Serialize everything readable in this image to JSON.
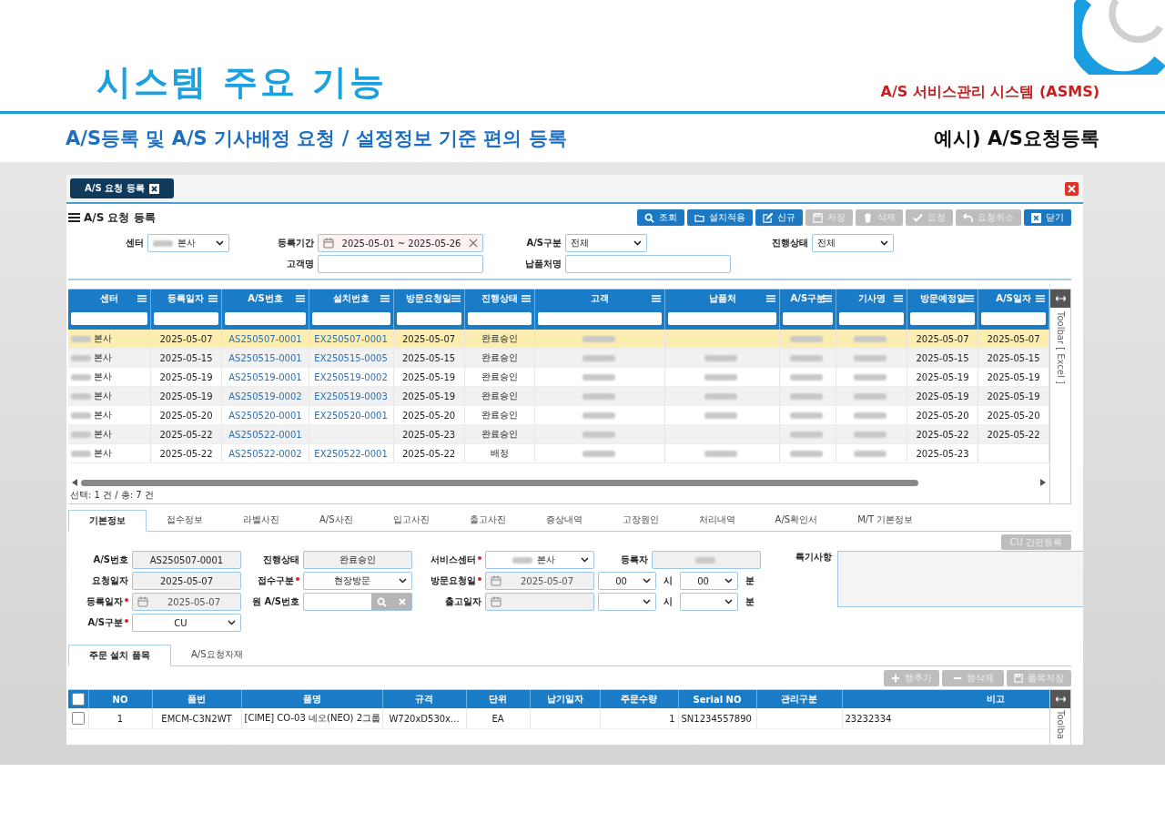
{
  "slide": {
    "title": "시스템 주요 기능",
    "system_name": "A/S 서비스관리 시스템 (ASMS)",
    "subtitle": "A/S등록 및 A/S 기사배정 요청 / 설정정보 기준 편의 등록",
    "example_label": "예시) A/S요청등록"
  },
  "window": {
    "tab": {
      "label": "A/S 요청 등록",
      "selected": true
    },
    "title": "A/S 요청 등록"
  },
  "toolbar": [
    {
      "label": "조회",
      "disabled": false
    },
    {
      "label": "설치적용",
      "disabled": false
    },
    {
      "label": "신규",
      "disabled": false
    },
    {
      "label": "저장",
      "disabled": true
    },
    {
      "label": "삭제",
      "disabled": true
    },
    {
      "label": "요청",
      "disabled": true
    },
    {
      "label": "요청취소",
      "disabled": true
    },
    {
      "label": "닫기",
      "disabled": false
    }
  ],
  "filter_rows": [
    [
      {
        "label": "센터",
        "kind": "select",
        "value": "본사",
        "blurred": true
      },
      {
        "label": "등록기간",
        "kind": "daterange",
        "value": "2025-05-01 ~ 2025-05-26"
      },
      {
        "label": "A/S구분",
        "kind": "select",
        "value": "전체"
      },
      {
        "label": "진행상태",
        "kind": "select",
        "value": "전체"
      }
    ],
    [
      {
        "label": "고객명",
        "kind": "input"
      },
      {
        "label": "납품처명",
        "kind": "input"
      }
    ]
  ],
  "grid": {
    "columns": [
      {
        "label": "센터",
        "kind": "text"
      },
      {
        "label": "등록일자",
        "kind": "text"
      },
      {
        "label": "A/S번호",
        "kind": "link"
      },
      {
        "label": "설치번호",
        "kind": "link"
      },
      {
        "label": "방문요청일",
        "kind": "text"
      },
      {
        "label": "진행상태",
        "kind": "text"
      },
      {
        "label": "고객",
        "kind": "text"
      },
      {
        "label": "납품처",
        "kind": "text"
      },
      {
        "label": "A/S구분",
        "kind": "text"
      },
      {
        "label": "기사명",
        "kind": "text"
      },
      {
        "label": "방문예정일",
        "kind": "text"
      },
      {
        "label": "A/S일자",
        "kind": "text"
      }
    ],
    "rows": [
      {
        "selected": true,
        "cells": [
          {
            "blurred": true,
            "text": "본사"
          },
          "2025-05-07",
          "AS250507-0001",
          "EX250507-0001",
          "2025-05-07",
          "완료승인",
          {
            "blurred": true
          },
          null,
          {
            "blurred": true
          },
          {
            "blurred": true
          },
          "2025-05-07",
          "2025-05-07"
        ]
      },
      {
        "selected": false,
        "cells": [
          {
            "blurred": true,
            "text": "본사"
          },
          "2025-05-15",
          "AS250515-0001",
          "EX250515-0005",
          "2025-05-15",
          "완료승인",
          {
            "blurred": true
          },
          {
            "blurred": true
          },
          {
            "blurred": true
          },
          {
            "blurred": true
          },
          "2025-05-15",
          "2025-05-15"
        ]
      },
      {
        "selected": false,
        "cells": [
          {
            "blurred": true,
            "text": "본사"
          },
          "2025-05-19",
          "AS250519-0001",
          "EX250519-0002",
          "2025-05-19",
          "완료승인",
          {
            "blurred": true
          },
          {
            "blurred": true
          },
          {
            "blurred": true
          },
          {
            "blurred": true
          },
          "2025-05-19",
          "2025-05-19"
        ]
      },
      {
        "selected": false,
        "cells": [
          {
            "blurred": true,
            "text": "본사"
          },
          "2025-05-19",
          "AS250519-0002",
          "EX250519-0003",
          "2025-05-19",
          "완료승인",
          {
            "blurred": true
          },
          {
            "blurred": true
          },
          {
            "blurred": true
          },
          {
            "blurred": true
          },
          "2025-05-19",
          "2025-05-19"
        ]
      },
      {
        "selected": false,
        "cells": [
          {
            "blurred": true,
            "text": "본사"
          },
          "2025-05-20",
          "AS250520-0001",
          "EX250520-0001",
          "2025-05-20",
          "완료승인",
          {
            "blurred": true
          },
          {
            "blurred": true
          },
          {
            "blurred": true
          },
          {
            "blurred": true
          },
          "2025-05-20",
          "2025-05-20"
        ]
      },
      {
        "selected": false,
        "cells": [
          {
            "blurred": true,
            "text": "본사"
          },
          "2025-05-22",
          "AS250522-0001",
          null,
          "2025-05-23",
          "완료승인",
          {
            "blurred": true
          },
          null,
          {
            "blurred": true
          },
          {
            "blurred": true
          },
          "2025-05-22",
          "2025-05-22"
        ]
      },
      {
        "selected": false,
        "cells": [
          {
            "blurred": true,
            "text": "본사"
          },
          "2025-05-22",
          "AS250522-0002",
          "EX250522-0001",
          "2025-05-22",
          "배정",
          {
            "blurred": true
          },
          {
            "blurred": true
          },
          {
            "blurred": true
          },
          {
            "blurred": true
          },
          "2025-05-23",
          null
        ]
      }
    ],
    "side_toolbar": "Toolbar [ Excel ]",
    "status": "선택: 1 건 / 총: 7 건"
  },
  "detail_tabs": [
    {
      "label": "기본정보",
      "selected": true
    },
    {
      "label": "접수정보",
      "selected": false
    },
    {
      "label": "라벨사진",
      "selected": false
    },
    {
      "label": "A/S사진",
      "selected": false
    },
    {
      "label": "입고사진",
      "selected": false
    },
    {
      "label": "출고사진",
      "selected": false
    },
    {
      "label": "증상내역",
      "selected": false
    },
    {
      "label": "고장원인",
      "selected": false
    },
    {
      "label": "처리내역",
      "selected": false
    },
    {
      "label": "A/S확인서",
      "selected": false
    },
    {
      "label": "M/T 기본정보",
      "selected": false
    }
  ],
  "quick_button": {
    "label": "CU 간편등록",
    "disabled": true
  },
  "form_rows": [
    [
      {
        "label": "A/S번호",
        "required": false,
        "kind": "readonly",
        "value": "AS250507-0001"
      },
      {
        "label": "진행상태",
        "required": false,
        "kind": "readonly",
        "value": "완료승인"
      },
      {
        "label": "서비스센터",
        "required": true,
        "kind": "select",
        "value": "본사",
        "blurred": true
      },
      {
        "label": "등록자",
        "required": false,
        "kind": "readonly",
        "blurred": true
      }
    ],
    [
      {
        "label": "요청일자",
        "required": false,
        "kind": "readonly",
        "value": "2025-05-07"
      },
      {
        "label": "접수구분",
        "required": true,
        "kind": "select",
        "value": "현장방문"
      },
      {
        "label": "방문요청일",
        "required": true,
        "kind": "datetime",
        "value": "2025-05-07",
        "hour": "00",
        "hour_unit": "시",
        "minute": "00",
        "minute_unit": "분"
      }
    ],
    [
      {
        "label": "등록일자",
        "required": true,
        "kind": "date",
        "value": "2025-05-07"
      },
      {
        "label": "원 A/S번호",
        "required": false,
        "kind": "search"
      },
      {
        "label": "출고일자",
        "required": false,
        "kind": "datetime",
        "hour_unit": "시",
        "minute_unit": "분"
      }
    ],
    [
      {
        "label": "A/S구분",
        "required": true,
        "kind": "select",
        "value": "CU"
      }
    ]
  ],
  "remarks": {
    "label": "특기사항"
  },
  "item_tabs": [
    {
      "label": "주문 설치 품목",
      "selected": true
    },
    {
      "label": "A/S요청자재",
      "selected": false
    }
  ],
  "item_buttons": [
    {
      "label": "행추가",
      "disabled": true
    },
    {
      "label": "행삭제",
      "disabled": true
    },
    {
      "label": "품목저장",
      "disabled": true
    }
  ],
  "items": {
    "header_checked": false,
    "columns": [
      "NO",
      "품번",
      "품명",
      "규격",
      "단위",
      "납기일자",
      "주문수량",
      "Serial NO",
      "관리구분",
      "비고"
    ],
    "rows": [
      {
        "checked": false,
        "cells": [
          "1",
          "EMCM-C3N2WT",
          "[CIME] CO-03 네오(NEO) 2그룹",
          "W720xD530x...",
          "EA",
          null,
          "1",
          "SN1234557890",
          null,
          "23232334"
        ]
      }
    ],
    "side_toolbar": "Toolba"
  }
}
